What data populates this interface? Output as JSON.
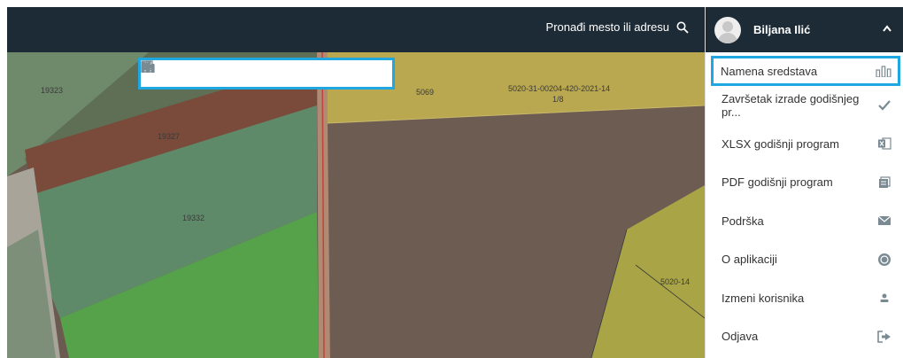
{
  "search": {
    "label": "Pronađi mesto ili adresu"
  },
  "user": {
    "name": "Biljana Ilić"
  },
  "map": {
    "parcel_labels": [
      "19323",
      "19327",
      "19332",
      "5069",
      "5020-31-00204-420-2021-14",
      "1/8",
      "5020-14"
    ]
  },
  "toolbar": {
    "tools": [
      {
        "icon": "bar-chart-icon"
      },
      {
        "icon": "briefcase-icon"
      },
      {
        "icon": "picture-icon"
      },
      {
        "icon": "dome-icon"
      },
      {
        "icon": "wrench-icon"
      },
      {
        "icon": "close-icon"
      }
    ]
  },
  "menu": {
    "items": [
      {
        "label": "Namena sredstava",
        "icon": "bar-chart-icon"
      },
      {
        "label": "Završetak izrade godišnjeg pr...",
        "icon": "check-icon"
      },
      {
        "label": "XLSX godišnji program",
        "icon": "excel-icon"
      },
      {
        "label": "PDF godišnji program",
        "icon": "document-icon"
      },
      {
        "label": "Podrška",
        "icon": "envelope-icon"
      },
      {
        "label": "O aplikaciji",
        "icon": "info-badge-icon"
      },
      {
        "label": "Izmeni korisnika",
        "icon": "user-icon"
      },
      {
        "label": "Odjava",
        "icon": "logout-icon"
      }
    ]
  },
  "colors": {
    "topbar": "#1c2b36",
    "highlight": "#1ea7e1",
    "icon": "#7a8a93"
  }
}
